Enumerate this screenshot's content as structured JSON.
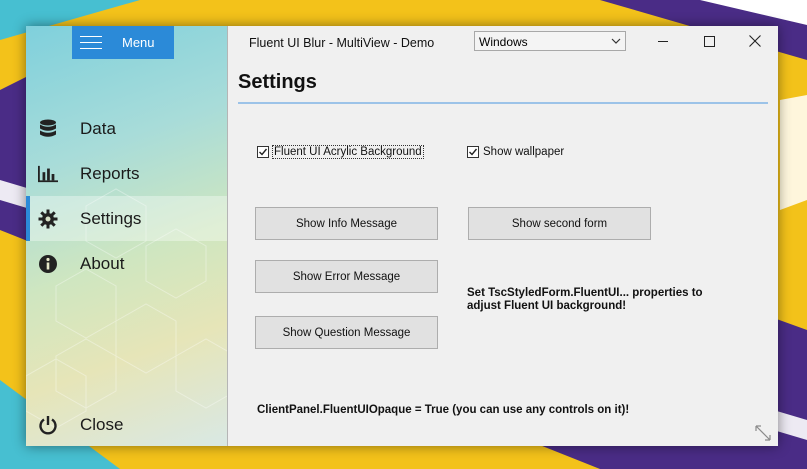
{
  "sidebar": {
    "menu_label": "Menu",
    "items": [
      {
        "label": "Data",
        "icon": "database-icon"
      },
      {
        "label": "Reports",
        "icon": "bar-chart-icon"
      },
      {
        "label": "Settings",
        "icon": "gear-icon"
      },
      {
        "label": "About",
        "icon": "info-icon"
      }
    ],
    "close_label": "Close",
    "active_item": "Settings"
  },
  "window": {
    "title": "Fluent UI Blur - MultiView - Demo",
    "style_combo_value": "Windows"
  },
  "settings": {
    "heading": "Settings",
    "acrylic_checkbox_label": "Fluent UI Acrylic Background",
    "acrylic_checked": true,
    "wallpaper_checkbox_label": "Show wallpaper",
    "wallpaper_checked": true,
    "buttons": {
      "info": "Show Info Message",
      "second_form": "Show second form",
      "error": "Show Error Message",
      "question": "Show Question Message"
    },
    "hint_line1": "Set TscStyledForm.FluentUI... properties to",
    "hint_line2": "adjust Fluent UI background!",
    "footer_note": "ClientPanel.FluentUIOpaque = True (you can use any controls on it)!"
  },
  "colors": {
    "accent": "#2b8ad8",
    "wallpaper_yellow": "#f3c21a",
    "wallpaper_purple": "#4a2c86",
    "wallpaper_teal": "#47bfd1"
  }
}
